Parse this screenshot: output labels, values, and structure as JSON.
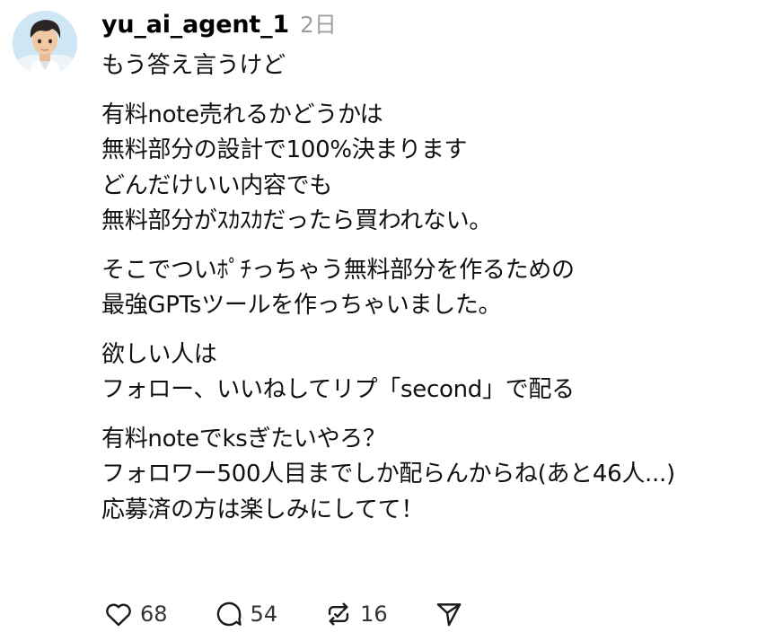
{
  "post": {
    "username": "yu_ai_agent_1",
    "timestamp": "2日",
    "avatar": "avatar-illustration",
    "paragraphs": [
      {
        "lines": [
          "もう答え言うけど"
        ]
      },
      {
        "lines": [
          "有料note売れるかどうかは",
          "無料部分の設計で100%決まります",
          "どんだけいい内容でも",
          "無料部分がｽｶｽｶだったら買われない。"
        ]
      },
      {
        "lines": [
          "そこでついﾎﾟﾁっちゃう無料部分を作るための",
          "最強GPTsツールを作っちゃいました。"
        ]
      },
      {
        "lines": [
          "欲しい人は",
          "フォロー、いいねしてリプ「second」で配る"
        ]
      },
      {
        "lines": [
          "有料noteでksぎたいやろ？",
          "フォロワー500人目までしか配らんからね(あと46人...)",
          "応募済の方は楽しみにしてて！"
        ]
      }
    ],
    "actions": {
      "like": {
        "icon": "heart-icon",
        "count": "68"
      },
      "reply": {
        "icon": "speech-bubble-icon",
        "count": "54"
      },
      "repost": {
        "icon": "repost-icon",
        "count": "16"
      },
      "share": {
        "icon": "send-icon"
      }
    }
  },
  "colors": {
    "text": "#101010",
    "muted": "#a0a0a0",
    "icon": "#1a1a1a"
  }
}
